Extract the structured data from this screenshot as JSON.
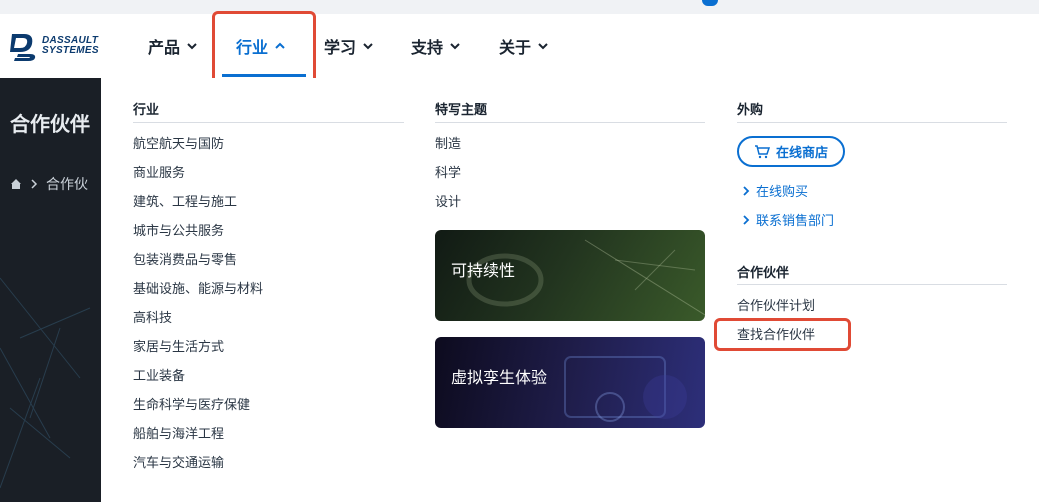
{
  "nav": {
    "items": [
      {
        "label": "产品"
      },
      {
        "label": "行业"
      },
      {
        "label": "学习"
      },
      {
        "label": "支持"
      },
      {
        "label": "关于"
      }
    ]
  },
  "logo": {
    "line1": "DASSAULT",
    "line2": "SYSTEMES"
  },
  "background_page": {
    "title": "合作伙伴",
    "breadcrumb": "合作伙"
  },
  "menu": {
    "industries": {
      "heading": "行业",
      "items": [
        "航空航天与国防",
        "商业服务",
        "建筑、工程与施工",
        "城市与公共服务",
        "包装消费品与零售",
        "基础设施、能源与材料",
        "高科技",
        "家居与生活方式",
        "工业装备",
        "生命科学与医疗保健",
        "船舶与海洋工程",
        "汽车与交通运输"
      ]
    },
    "featured": {
      "heading": "特写主题",
      "items": [
        "制造",
        "科学",
        "设计"
      ],
      "cards": [
        {
          "label": "可持续性"
        },
        {
          "label": "虚拟孪生体验"
        }
      ]
    },
    "buy": {
      "heading": "外购",
      "shop_button": "在线商店",
      "links": [
        "在线购买",
        "联系销售部门"
      ]
    },
    "partners": {
      "heading": "合作伙伴",
      "links": [
        "合作伙伴计划",
        "查找合作伙伴"
      ]
    }
  },
  "colors": {
    "accent": "#0a6fd1",
    "highlight": "#e04a35"
  }
}
